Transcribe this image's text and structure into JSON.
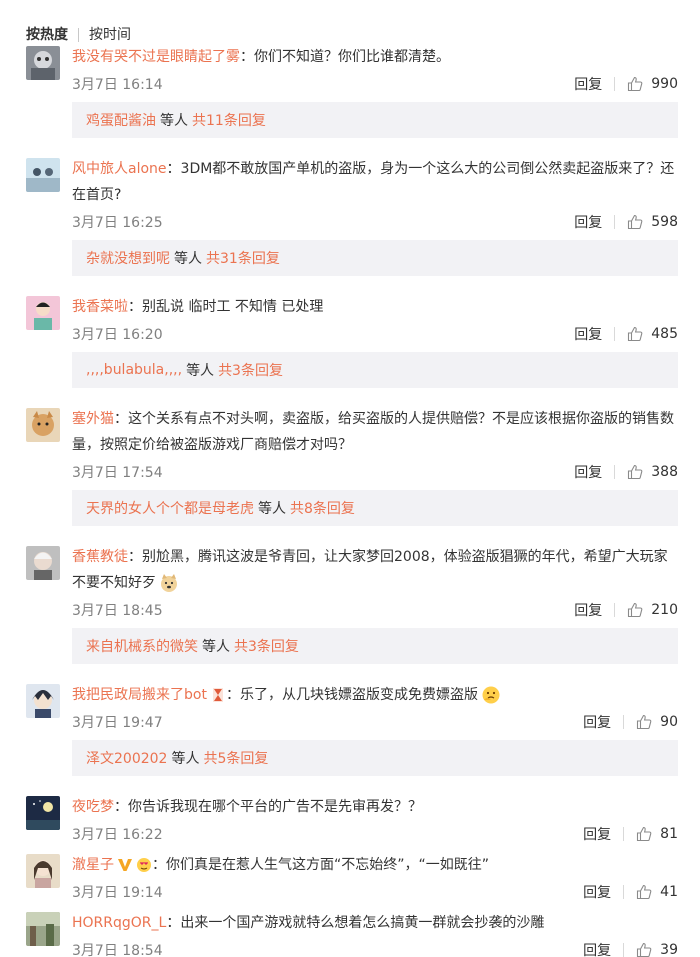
{
  "sort": {
    "hot": "按热度",
    "time": "按时间"
  },
  "labels": {
    "reply": "回复",
    "etc": "等人"
  },
  "colors": {
    "username": "#eb7350",
    "subbg": "#f2f2f5"
  },
  "comments": [
    {
      "user": "我没有哭不过是眼睛起了雾",
      "text": "你们不知道？你们比谁都清楚。",
      "time": "3月7日 16:14",
      "likes": "990",
      "sub": {
        "name": "鸡蛋配酱油",
        "total": "共11条回复"
      }
    },
    {
      "user": "风中旅人alone",
      "text": "3DM都不敢放国产单机的盗版，身为一个这么大的公司倒公然卖起盗版来了？还在首页?",
      "time": "3月7日 16:25",
      "likes": "598",
      "sub": {
        "name": "杂就没想到呢",
        "total": "共31条回复"
      }
    },
    {
      "user": "我香菜啦",
      "text": "别乱说 临时工 不知情 已处理",
      "time": "3月7日 16:20",
      "likes": "485",
      "sub": {
        "name": ",,,,bulabula,,,,",
        "total": "共3条回复"
      }
    },
    {
      "user": "塞外猫",
      "text": "这个关系有点不对头啊，卖盗版，给买盗版的人提供赔偿？不是应该根据你盗版的销售数量，按照定价给被盗版游戏厂商赔偿才对吗？",
      "time": "3月7日 17:54",
      "likes": "388",
      "sub": {
        "name": "天界的女人个个都是母老虎",
        "total": "共8条回复"
      }
    },
    {
      "user": "香蕉教徒",
      "text": "别尬黑，腾讯这波是爷青回，让大家梦回2008，体验盗版猖獗的年代，希望广大玩家不要不知好歹",
      "time": "3月7日 18:45",
      "likes": "210",
      "sub": {
        "name": "来自机械系的微笑",
        "total": "共3条回复"
      }
    },
    {
      "user": "我把民政局搬来了bot",
      "text": "乐了，从几块钱嫖盗版变成免费嫖盗版",
      "time": "3月7日 19:47",
      "likes": "90",
      "sub": {
        "name": "泽文200202",
        "total": "共5条回复"
      }
    },
    {
      "user": "夜吃梦",
      "text": "你告诉我现在哪个平台的广告不是先审再发？？",
      "time": "3月7日 16:22",
      "likes": "81"
    },
    {
      "user": "澈星子",
      "text": "你们真是在惹人生气这方面“不忘始终”，“一如既往”",
      "time": "3月7日 19:14",
      "likes": "41"
    },
    {
      "user": "HORRqgOR_L",
      "text": "出来一个国产游戏就特么想着怎么搞黄一群就会抄袭的沙雕",
      "time": "3月7日 18:54",
      "likes": "39"
    }
  ]
}
